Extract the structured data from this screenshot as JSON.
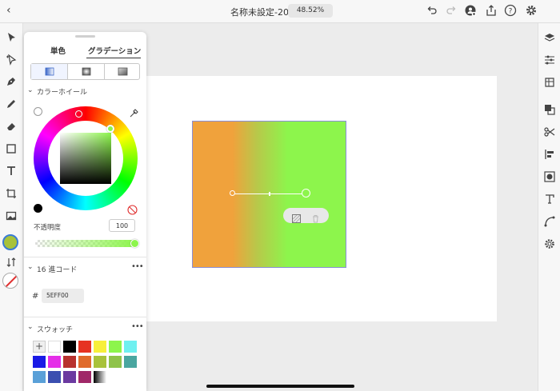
{
  "topbar": {
    "back_label": "‹",
    "doc_title": "名称未設定-20",
    "zoom": "48.52%",
    "icons": [
      "undo-icon",
      "redo-icon",
      "add-user-icon",
      "share-icon",
      "help-icon",
      "settings-icon"
    ]
  },
  "left_tools": [
    "select-icon",
    "direct-select-icon",
    "pen-icon",
    "pencil-icon",
    "eraser-icon",
    "rectangle-icon",
    "text-icon",
    "transform-icon",
    "image-icon",
    "fill-swatch",
    "swap-icon",
    "stroke-swatch"
  ],
  "right_tools": [
    "layers-icon",
    "properties-icon",
    "libraries-icon",
    "pathfinder-icon",
    "scissors-icon",
    "align-icon",
    "mask-icon",
    "type-icon",
    "curve-icon",
    "gear-icon"
  ],
  "panel": {
    "tabs": [
      {
        "label": "単色",
        "active": false
      },
      {
        "label": "グラデーション",
        "active": true
      }
    ],
    "gradient_types": [
      "linear-gradient-icon",
      "radial-gradient-icon",
      "freeform-gradient-icon"
    ],
    "color_wheel": {
      "title": "カラーホイール",
      "marker_color": "#8DF54C"
    },
    "opacity": {
      "label": "不透明度",
      "value": "100"
    },
    "hex": {
      "title": "16 進コード",
      "prefix": "#",
      "value": "5EFF00"
    },
    "swatches": {
      "title": "スウォッチ",
      "colors": [
        "#ffffff",
        "#000000",
        "#e63222",
        "#f7ef3a",
        "#8df54c",
        "#6ff0f0",
        "#1a1ae6",
        "#e52ee8",
        "#b8322e",
        "#e06b2c",
        "#a8c23a",
        "#8fc34a",
        "#4aa6a0",
        "#5aa0d8",
        "#3b4fb0",
        "#6b3aa0",
        "#a02868"
      ]
    }
  },
  "artboard": {
    "gradient": {
      "stops": [
        "#f0a23c",
        "#8df54c"
      ]
    }
  }
}
